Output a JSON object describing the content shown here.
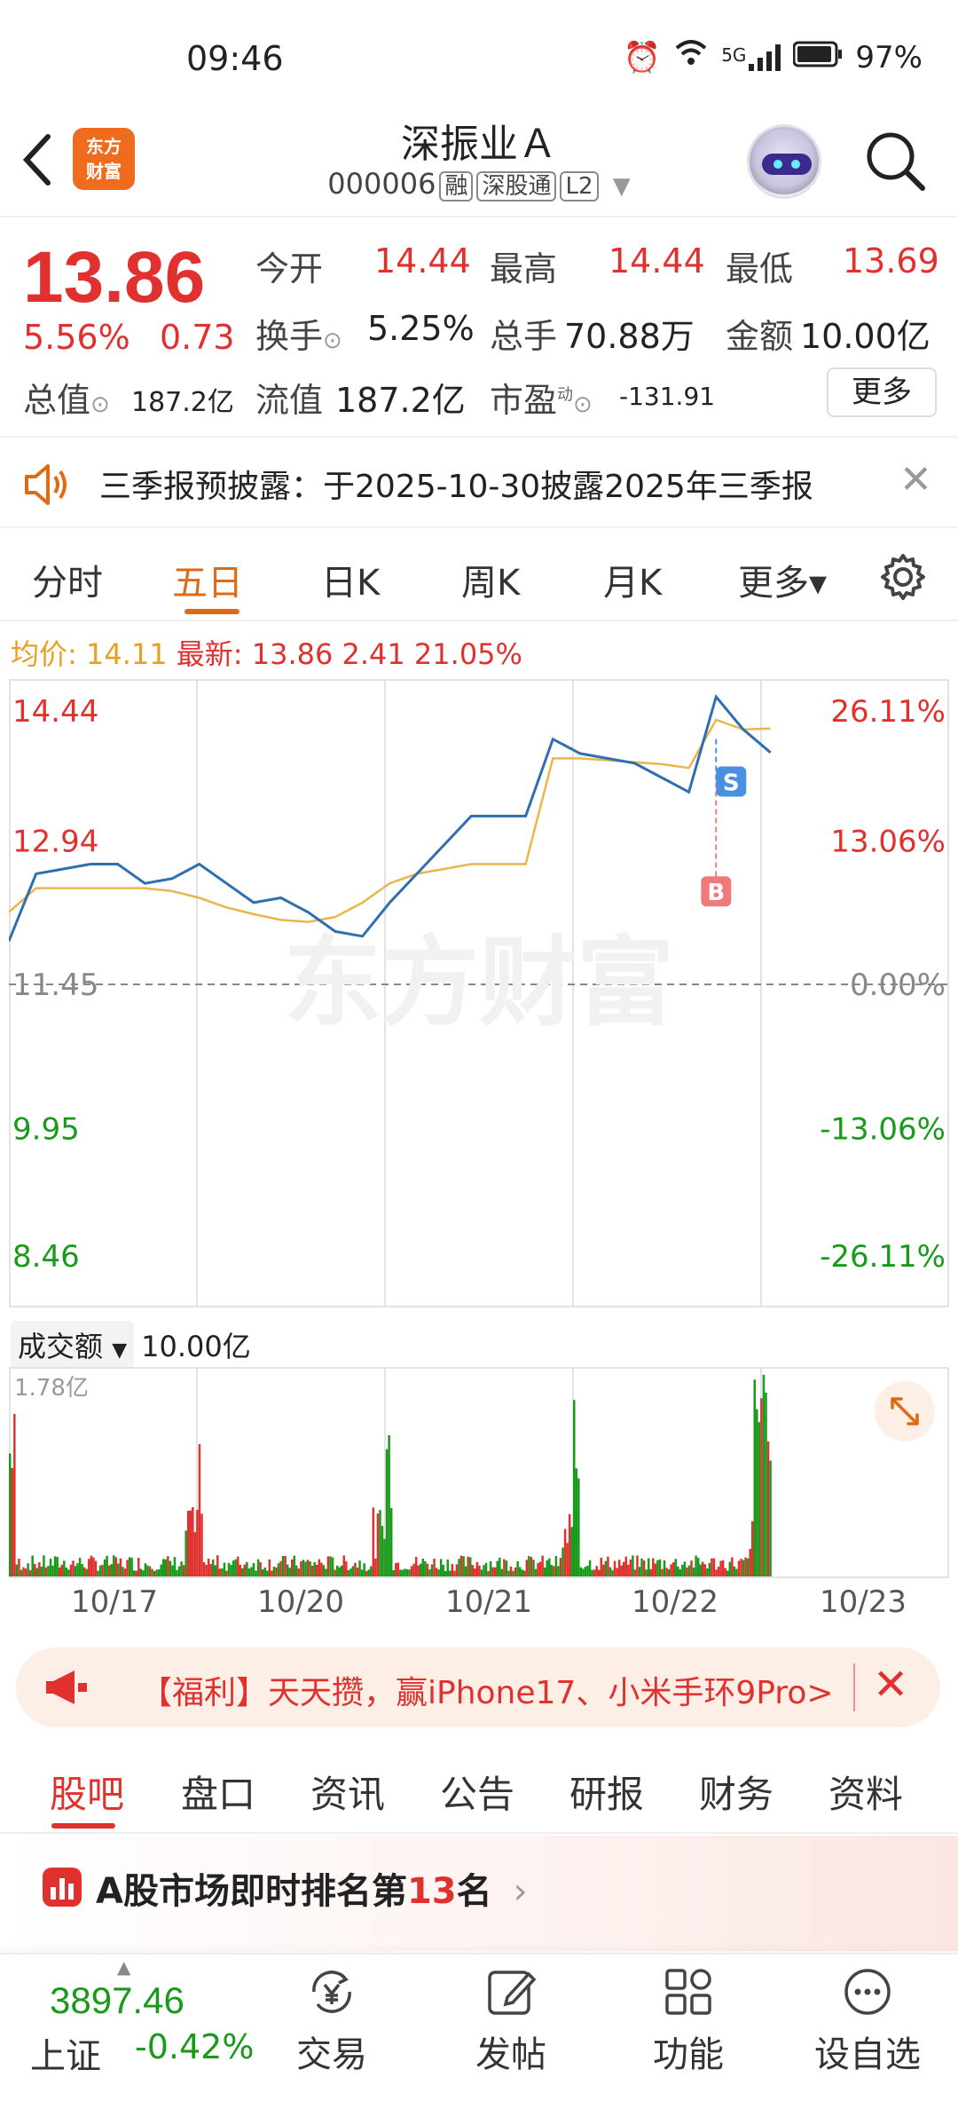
{
  "status": {
    "time": "09:46",
    "battery": "97%",
    "net": "5G"
  },
  "header": {
    "logo_text": [
      "东方",
      "财富"
    ],
    "name": "深振业Ａ",
    "code": "000006",
    "tags": [
      "融",
      "深股通",
      "L2"
    ]
  },
  "quote": {
    "price": "13.86",
    "pct": "5.56%",
    "change": "0.73",
    "open_label": "今开",
    "open": "14.44",
    "high_label": "最高",
    "high": "14.44",
    "low_label": "最低",
    "low": "13.69",
    "turnover_label": "换手",
    "turnover": "5.25%",
    "volume_label": "总手",
    "volume": "70.88万",
    "amount_label": "金额",
    "amount": "10.00亿",
    "mcap_label": "总值",
    "mcap": "187.2亿",
    "float_label": "流值",
    "float": "187.2亿",
    "pe_label": "市盈",
    "pe_sup": "动",
    "pe": "-131.91",
    "more": "更多"
  },
  "notice": {
    "text": "三季报预披露：于2025-10-30披露2025年三季报"
  },
  "chart_tabs": [
    "分时",
    "五日",
    "日K",
    "周K",
    "月K",
    "更多▾"
  ],
  "avg_line": {
    "label_avg": "均价:",
    "avg": "14.11",
    "label_latest": "最新:",
    "latest": "13.86",
    "chg": "2.41",
    "pct": "21.05%"
  },
  "chart_data": {
    "type": "line",
    "title": "",
    "x": [
      "10/17",
      "10/20",
      "10/21",
      "10/22",
      "10/23"
    ],
    "ylim": [
      8.46,
      14.44
    ],
    "y_ticks_left": [
      "14.44",
      "12.94",
      "11.45",
      "9.95",
      "8.46"
    ],
    "y_ticks_right": [
      "26.11%",
      "13.06%",
      "0.00%",
      "-13.06%",
      "-26.11%"
    ],
    "reference": 11.45,
    "series": [
      {
        "values": [
          11.9,
          12.6,
          12.65,
          12.7,
          12.7,
          12.5,
          12.55,
          12.7,
          12.5,
          12.3,
          12.35,
          12.2,
          12.0,
          11.95,
          12.3,
          12.6,
          12.9,
          13.2,
          13.2,
          13.2,
          14.0,
          13.85,
          13.8,
          13.75,
          13.6,
          13.45,
          14.44,
          14.1,
          13.86
        ]
      },
      {
        "values": [
          12.2,
          12.45,
          12.45,
          12.45,
          12.45,
          12.45,
          12.42,
          12.35,
          12.25,
          12.18,
          12.12,
          12.1,
          12.15,
          12.3,
          12.5,
          12.6,
          12.65,
          12.7,
          12.7,
          12.7,
          13.8,
          13.8,
          13.78,
          13.76,
          13.74,
          13.7,
          14.2,
          14.1,
          14.11
        ]
      }
    ],
    "markers": [
      {
        "label": "S"
      },
      {
        "label": "B"
      }
    ],
    "volume": {
      "label": "成交额",
      "value": "10.00亿",
      "max_label": "1.78亿"
    },
    "watermark": "东方财富"
  },
  "promo": {
    "text": "【福利】天天攒，赢iPhone17、小米手环9Pro>"
  },
  "lower_tabs": [
    "股吧",
    "盘口",
    "资讯",
    "公告",
    "研报",
    "财务",
    "资料"
  ],
  "rank": {
    "prefix": "A股市场即时排名第",
    "num": "13",
    "suffix": "名",
    "arrow": "›"
  },
  "bottom": {
    "index_value": "3897.46",
    "index_name": "上证",
    "index_change": "-0.42%",
    "nav": [
      "交易",
      "发帖",
      "功能",
      "设自选"
    ]
  },
  "colors": {
    "up": "#e0312f",
    "down": "#1a9a1a",
    "price_line": "#2f6fb0",
    "avg_line": "#e9b64b",
    "accent": "#e06a14"
  }
}
